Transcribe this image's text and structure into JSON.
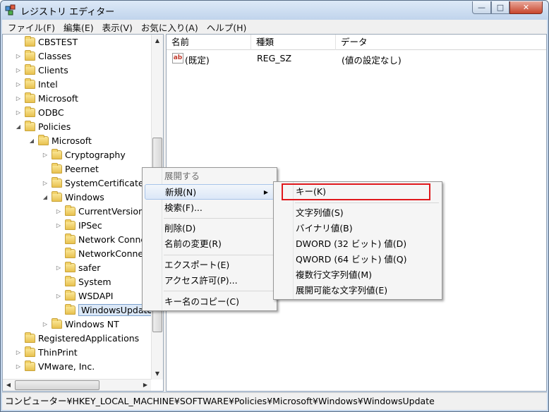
{
  "window": {
    "title": "レジストリ エディター",
    "min": "—",
    "max": "□",
    "close": "✕"
  },
  "menu": [
    "ファイル(F)",
    "編集(E)",
    "表示(V)",
    "お気に入り(A)",
    "ヘルプ(H)"
  ],
  "tree": [
    {
      "label": "CBSTEST",
      "indent": 0,
      "expander": "",
      "expanded": false
    },
    {
      "label": "Classes",
      "indent": 0,
      "expander": "▷",
      "expanded": false
    },
    {
      "label": "Clients",
      "indent": 0,
      "expander": "▷",
      "expanded": false
    },
    {
      "label": "Intel",
      "indent": 0,
      "expander": "▷",
      "expanded": false
    },
    {
      "label": "Microsoft",
      "indent": 0,
      "expander": "▷",
      "expanded": false
    },
    {
      "label": "ODBC",
      "indent": 0,
      "expander": "▷",
      "expanded": false
    },
    {
      "label": "Policies",
      "indent": 0,
      "expander": "◢",
      "expanded": true
    },
    {
      "label": "Microsoft",
      "indent": 1,
      "expander": "◢",
      "expanded": true
    },
    {
      "label": "Cryptography",
      "indent": 2,
      "expander": "▷",
      "expanded": false
    },
    {
      "label": "Peernet",
      "indent": 2,
      "expander": "",
      "expanded": false
    },
    {
      "label": "SystemCertificates",
      "indent": 2,
      "expander": "▷",
      "expanded": false
    },
    {
      "label": "Windows",
      "indent": 2,
      "expander": "◢",
      "expanded": true
    },
    {
      "label": "CurrentVersion",
      "indent": 3,
      "expander": "▷",
      "expanded": false
    },
    {
      "label": "IPSec",
      "indent": 3,
      "expander": "▷",
      "expanded": false
    },
    {
      "label": "Network Conne",
      "indent": 3,
      "expander": "",
      "expanded": false
    },
    {
      "label": "NetworkConnec",
      "indent": 3,
      "expander": "",
      "expanded": false
    },
    {
      "label": "safer",
      "indent": 3,
      "expander": "▷",
      "expanded": false
    },
    {
      "label": "System",
      "indent": 3,
      "expander": "",
      "expanded": false
    },
    {
      "label": "WSDAPI",
      "indent": 3,
      "expander": "▷",
      "expanded": false
    },
    {
      "label": "WindowsUpdate",
      "indent": 3,
      "expander": "",
      "expanded": false,
      "selected": true
    },
    {
      "label": "Windows NT",
      "indent": 2,
      "expander": "▷",
      "expanded": false
    },
    {
      "label": "RegisteredApplications",
      "indent": 0,
      "expander": "",
      "expanded": false
    },
    {
      "label": "ThinPrint",
      "indent": 0,
      "expander": "▷",
      "expanded": false
    },
    {
      "label": "VMware, Inc.",
      "indent": 0,
      "expander": "▷",
      "expanded": false
    }
  ],
  "list": {
    "columns": [
      "名前",
      "種類",
      "データ"
    ],
    "rows": [
      {
        "name": "(既定)",
        "type": "REG_SZ",
        "data": "(値の設定なし)"
      }
    ]
  },
  "context_menu": {
    "items": [
      {
        "label": "展開する",
        "disabled": true
      },
      {
        "label": "新規(N)",
        "submenu": true,
        "highlighted": true
      },
      {
        "label": "検索(F)..."
      },
      {
        "label": "削除(D)"
      },
      {
        "label": "名前の変更(R)"
      },
      {
        "label": "エクスポート(E)"
      },
      {
        "label": "アクセス許可(P)..."
      },
      {
        "label": "キー名のコピー(C)"
      }
    ]
  },
  "submenu": {
    "items": [
      "キー(K)",
      "文字列値(S)",
      "バイナリ値(B)",
      "DWORD (32 ビット) 値(D)",
      "QWORD (64 ビット) 値(Q)",
      "複数行文字列値(M)",
      "展開可能な文字列値(E)"
    ]
  },
  "status": "コンピューター¥HKEY_LOCAL_MACHINE¥SOFTWARE¥Policies¥Microsoft¥Windows¥WindowsUpdate",
  "colors": {
    "highlight_box": "#e0181c",
    "title_gradient": "#c0d4ec"
  }
}
